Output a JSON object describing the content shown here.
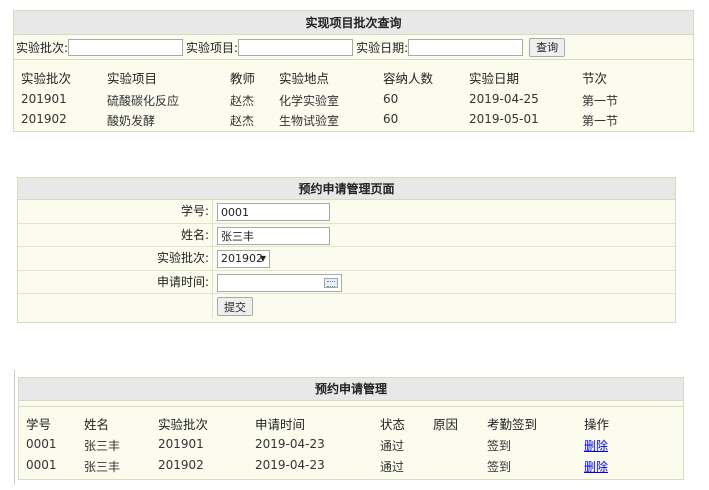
{
  "query_panel": {
    "title": "实现项目批次查询",
    "search": {
      "batch_label": "实验批次:",
      "batch_value": "",
      "project_label": "实验项目:",
      "project_value": "",
      "date_label": "实验日期:",
      "date_value": "",
      "button_label": "查询"
    },
    "table": {
      "headers": [
        "实验批次",
        "实验项目",
        "教师",
        "实验地点",
        "容纳人数",
        "实验日期",
        "节次"
      ],
      "rows": [
        [
          "201901",
          "硫酸碳化反应",
          "赵杰",
          "化学实验室",
          "60",
          "2019-04-25",
          "第一节"
        ],
        [
          "201902",
          "酸奶发酵",
          "赵杰",
          "生物试验室",
          "60",
          "2019-05-01",
          "第一节"
        ]
      ]
    }
  },
  "application_form": {
    "title": "预约申请管理页面",
    "student_id_label": "学号:",
    "student_id_value": "0001",
    "name_label": "姓名:",
    "name_value": "张三丰",
    "batch_label": "实验批次:",
    "batch_selected": "201902",
    "apply_time_label": "申请时间:",
    "apply_time_value": "",
    "submit_label": "提交"
  },
  "management_panel": {
    "title": "预约申请管理",
    "table": {
      "headers": [
        "学号",
        "姓名",
        "实验批次",
        "申请时间",
        "状态",
        "原因",
        "考勤签到",
        "操作"
      ],
      "rows": [
        [
          "0001",
          "张三丰",
          "201901",
          "2019-04-23",
          "通过",
          "",
          "签到",
          "删除"
        ],
        [
          "0001",
          "张三丰",
          "201902",
          "2019-04-23",
          "通过",
          "",
          "签到",
          "删除"
        ]
      ]
    }
  },
  "icons": {
    "select_caret": "chevron-down-icon",
    "date_picker": "calendar-icon"
  }
}
